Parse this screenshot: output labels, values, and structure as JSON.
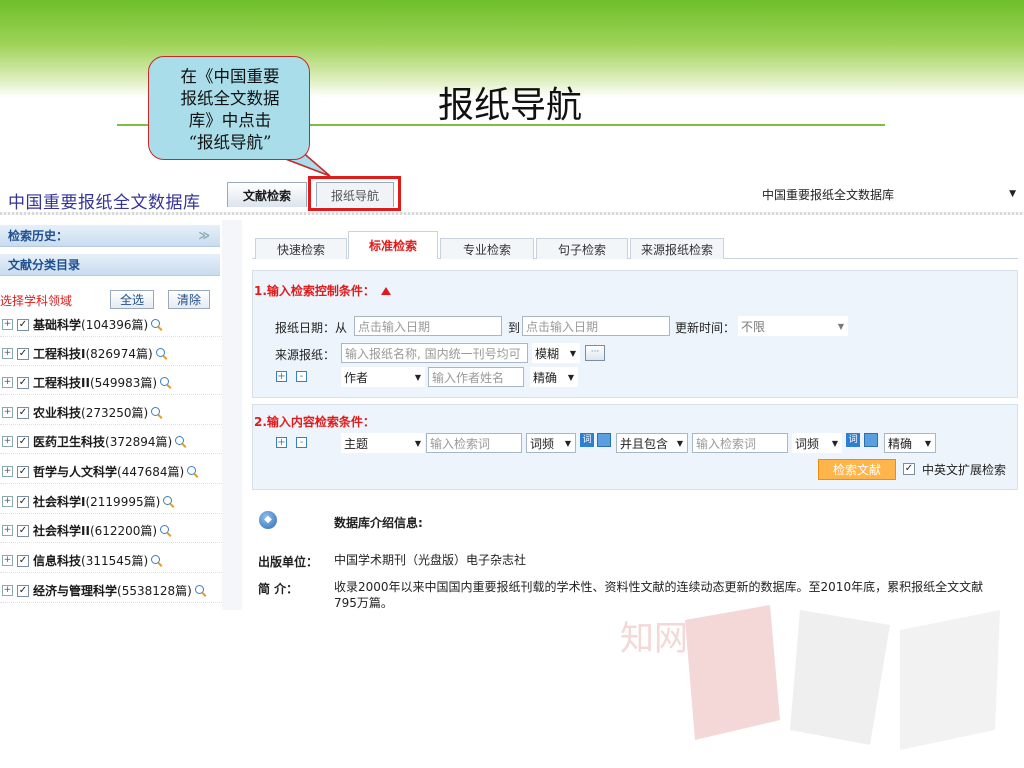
{
  "slide": {
    "title": "报纸导航"
  },
  "callout": {
    "lines": [
      "在《中国重要",
      "报纸全文数据",
      "库》中点击",
      "“报纸导航”"
    ]
  },
  "app": {
    "logo": "中国重要报纸全文数据库",
    "main_tabs": [
      "文献检索",
      "报纸导航"
    ],
    "db_select": "中国重要报纸全文数据库"
  },
  "sidebar": {
    "history": "检索历史：",
    "catalog": "文献分类目录",
    "subject_label": "选择学科领域",
    "select_all": "全选",
    "clear": "清除",
    "categories": [
      {
        "name": "基础科学",
        "count": "(104396篇)"
      },
      {
        "name": "工程科技I",
        "count": "(826974篇)"
      },
      {
        "name": "工程科技II",
        "count": "(549983篇)"
      },
      {
        "name": "农业科技",
        "count": "(273250篇)"
      },
      {
        "name": "医药卫生科技",
        "count": "(372894篇)"
      },
      {
        "name": "哲学与人文科学",
        "count": "(447684篇)"
      },
      {
        "name": "社会科学I",
        "count": "(2119995篇)"
      },
      {
        "name": "社会科学II",
        "count": "(612200篇)"
      },
      {
        "name": "信息科技",
        "count": "(311545篇)"
      },
      {
        "name": "经济与管理科学",
        "count": "(5538128篇)"
      }
    ]
  },
  "search": {
    "tabs": [
      "快速检索",
      "标准检索",
      "专业检索",
      "句子检索",
      "来源报纸检索"
    ],
    "section1": "1.输入检索控制条件：",
    "date_label": "报纸日期：从",
    "date_from": "点击输入日期",
    "date_to_label": "到",
    "date_to": "点击输入日期",
    "update_label": "更新时间：",
    "update_value": "不限",
    "source_label": "来源报纸：",
    "source_placeholder": "输入报纸名称, 国内统一刊号均可",
    "match_fuzzy": "模糊",
    "dots": "···",
    "author_field": "作者",
    "author_placeholder": "输入作者姓名",
    "match_exact": "精确",
    "section2": "2.输入内容检索条件：",
    "topic_field": "主题",
    "keyword_placeholder": "输入检索词",
    "freq": "词频",
    "and_contains": "并且包含",
    "keyword_placeholder2": "输入检索词",
    "freq2": "词频",
    "exact2": "精确",
    "plus": "+",
    "minus": "-",
    "search_button": "检索文献",
    "ext_search": "中英文扩展检索"
  },
  "info": {
    "title": "数据库介绍信息:",
    "publisher_label": "出版单位：",
    "publisher": "中国学术期刊（光盘版）电子杂志社",
    "intro_label": "简 介：",
    "intro_line1": "收录2000年以来中国国内重要报纸刊载的学术性、资料性文献的连续动态更新的数据库。至2010年底，累积报纸全文文献",
    "intro_line2": "795万篇。"
  },
  "watermark": {
    "text": "知网"
  },
  "colors": {
    "accent_red": "#e01b1b",
    "brand_blue": "#333399",
    "band_green": "#6fbf2b"
  }
}
